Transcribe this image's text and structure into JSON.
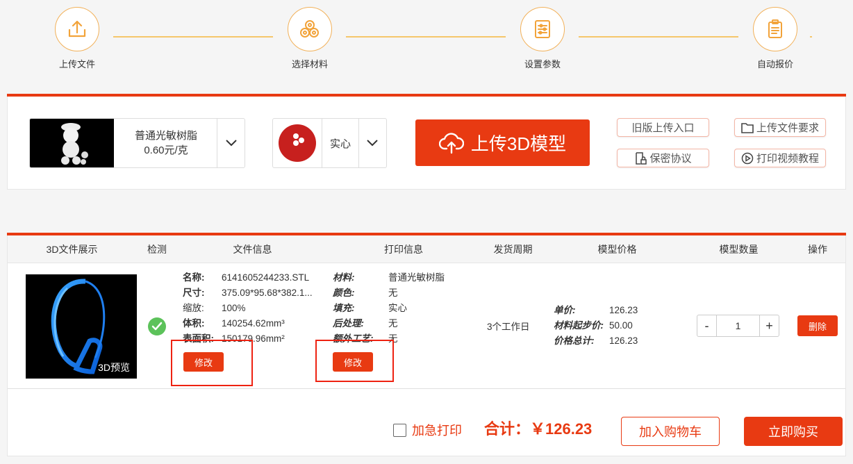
{
  "steps": [
    "上传文件",
    "选择材料",
    "设置参数",
    "自动报价"
  ],
  "material": {
    "name": "普通光敏树脂",
    "price": "0.60元/克"
  },
  "fill": {
    "label": "实心"
  },
  "upload_button": "上传3D模型",
  "links": {
    "old_upload": "旧版上传入口",
    "file_requirements": "上传文件要求",
    "privacy": "保密协议",
    "video": "打印视频教程"
  },
  "table": {
    "headers": [
      "3D文件展示",
      "检测",
      "文件信息",
      "打印信息",
      "发货周期",
      "模型价格",
      "模型数量",
      "操作"
    ],
    "row": {
      "preview_label": "3D预览",
      "file_info": [
        {
          "k": "名称:",
          "v": "6141605244233.STL"
        },
        {
          "k": "尺寸:",
          "v": "375.09*95.68*382.1..."
        },
        {
          "k": "缩放:",
          "v": "100%"
        },
        {
          "k": "体积:",
          "v": "140254.62mm³"
        },
        {
          "k": "表面积:",
          "v": "150179.96mm²"
        }
      ],
      "print_info": [
        {
          "k": "材料:",
          "v": "普通光敏树脂"
        },
        {
          "k": "颜色:",
          "v": "无"
        },
        {
          "k": "填充:",
          "v": "实心"
        },
        {
          "k": "后处理:",
          "v": "无"
        },
        {
          "k": "额外工艺:",
          "v": "无"
        }
      ],
      "edit_label": "修改",
      "cycle": "3个工作日",
      "price": [
        {
          "k": "单价:",
          "v": "126.23"
        },
        {
          "k": "材料起步价:",
          "v": "50.00"
        },
        {
          "k": "价格总计:",
          "v": "126.23"
        }
      ],
      "quantity": "1",
      "minus": "-",
      "plus": "+",
      "delete_label": "删除"
    }
  },
  "footer": {
    "urgent": "加急打印",
    "total": "合计：￥126.23",
    "add_cart": "加入购物车",
    "buy_now": "立即购买"
  },
  "colors": {
    "accent": "#e83a12",
    "step_border": "#f2b15a",
    "step_line": "#f5c66b",
    "success": "#5cc25a"
  }
}
